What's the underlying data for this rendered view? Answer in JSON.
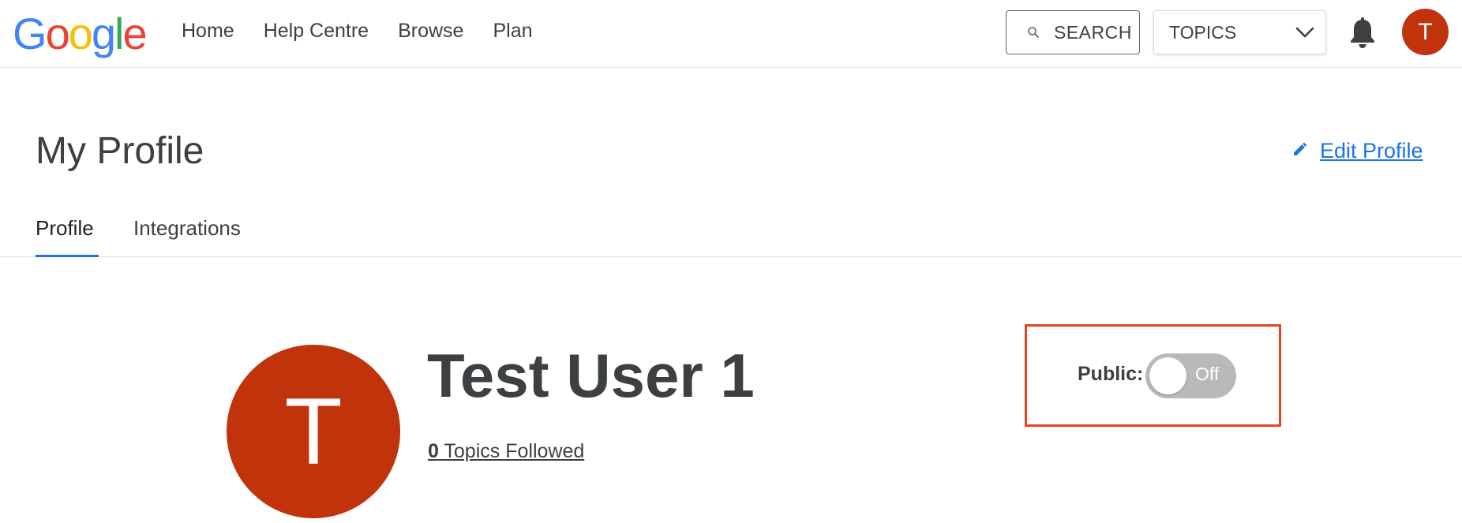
{
  "brand": {
    "logo_letters": [
      "G",
      "o",
      "o",
      "g",
      "l",
      "e"
    ],
    "logo_colors": [
      "#4285F4",
      "#EA4335",
      "#FBBC05",
      "#4285F4",
      "#34A853",
      "#EA4335"
    ]
  },
  "nav": {
    "items": [
      "Home",
      "Help Centre",
      "Browse",
      "Plan"
    ]
  },
  "header": {
    "search_label": "SEARCH",
    "search_icon": "search-icon",
    "topics_label": "TOPICS",
    "topics_icon": "chevron-down-icon",
    "notifications_icon": "bell-icon",
    "avatar_initial": "T",
    "avatar_color": "#c1330a"
  },
  "page": {
    "title": "My Profile",
    "edit_label": "Edit Profile",
    "edit_icon": "pencil-icon"
  },
  "tabs": [
    {
      "label": "Profile",
      "active": true
    },
    {
      "label": "Integrations",
      "active": false
    }
  ],
  "profile": {
    "avatar_initial": "T",
    "name": "Test User 1",
    "topics_count": "0",
    "topics_label": "Topics Followed",
    "public_label": "Public:",
    "public_state": "Off",
    "public_enabled": false
  },
  "colors": {
    "accent": "#1a73e8",
    "highlight_border": "#e8431f",
    "toggle_off": "#b9b9b9"
  }
}
